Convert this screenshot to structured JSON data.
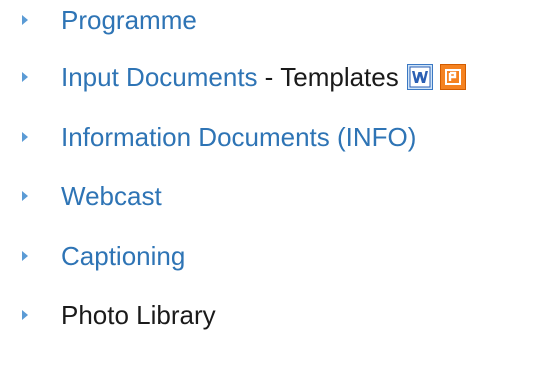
{
  "nav": {
    "items": [
      {
        "label": "Programme"
      },
      {
        "label": "Input Documents",
        "separator": "-",
        "suffix": "Templates"
      },
      {
        "label": "Information Documents (INFO)"
      },
      {
        "label": "Webcast"
      },
      {
        "label": "Captioning"
      },
      {
        "label": "Photo Library"
      }
    ]
  },
  "colors": {
    "link": "#2e74b5",
    "bullet": "#5b9bd5",
    "text": "#1a1a1a",
    "word_blue": "#2b5fb4",
    "ppt_orange": "#f58220"
  },
  "icons": {
    "word": "word-template-icon",
    "powerpoint": "powerpoint-template-icon"
  }
}
